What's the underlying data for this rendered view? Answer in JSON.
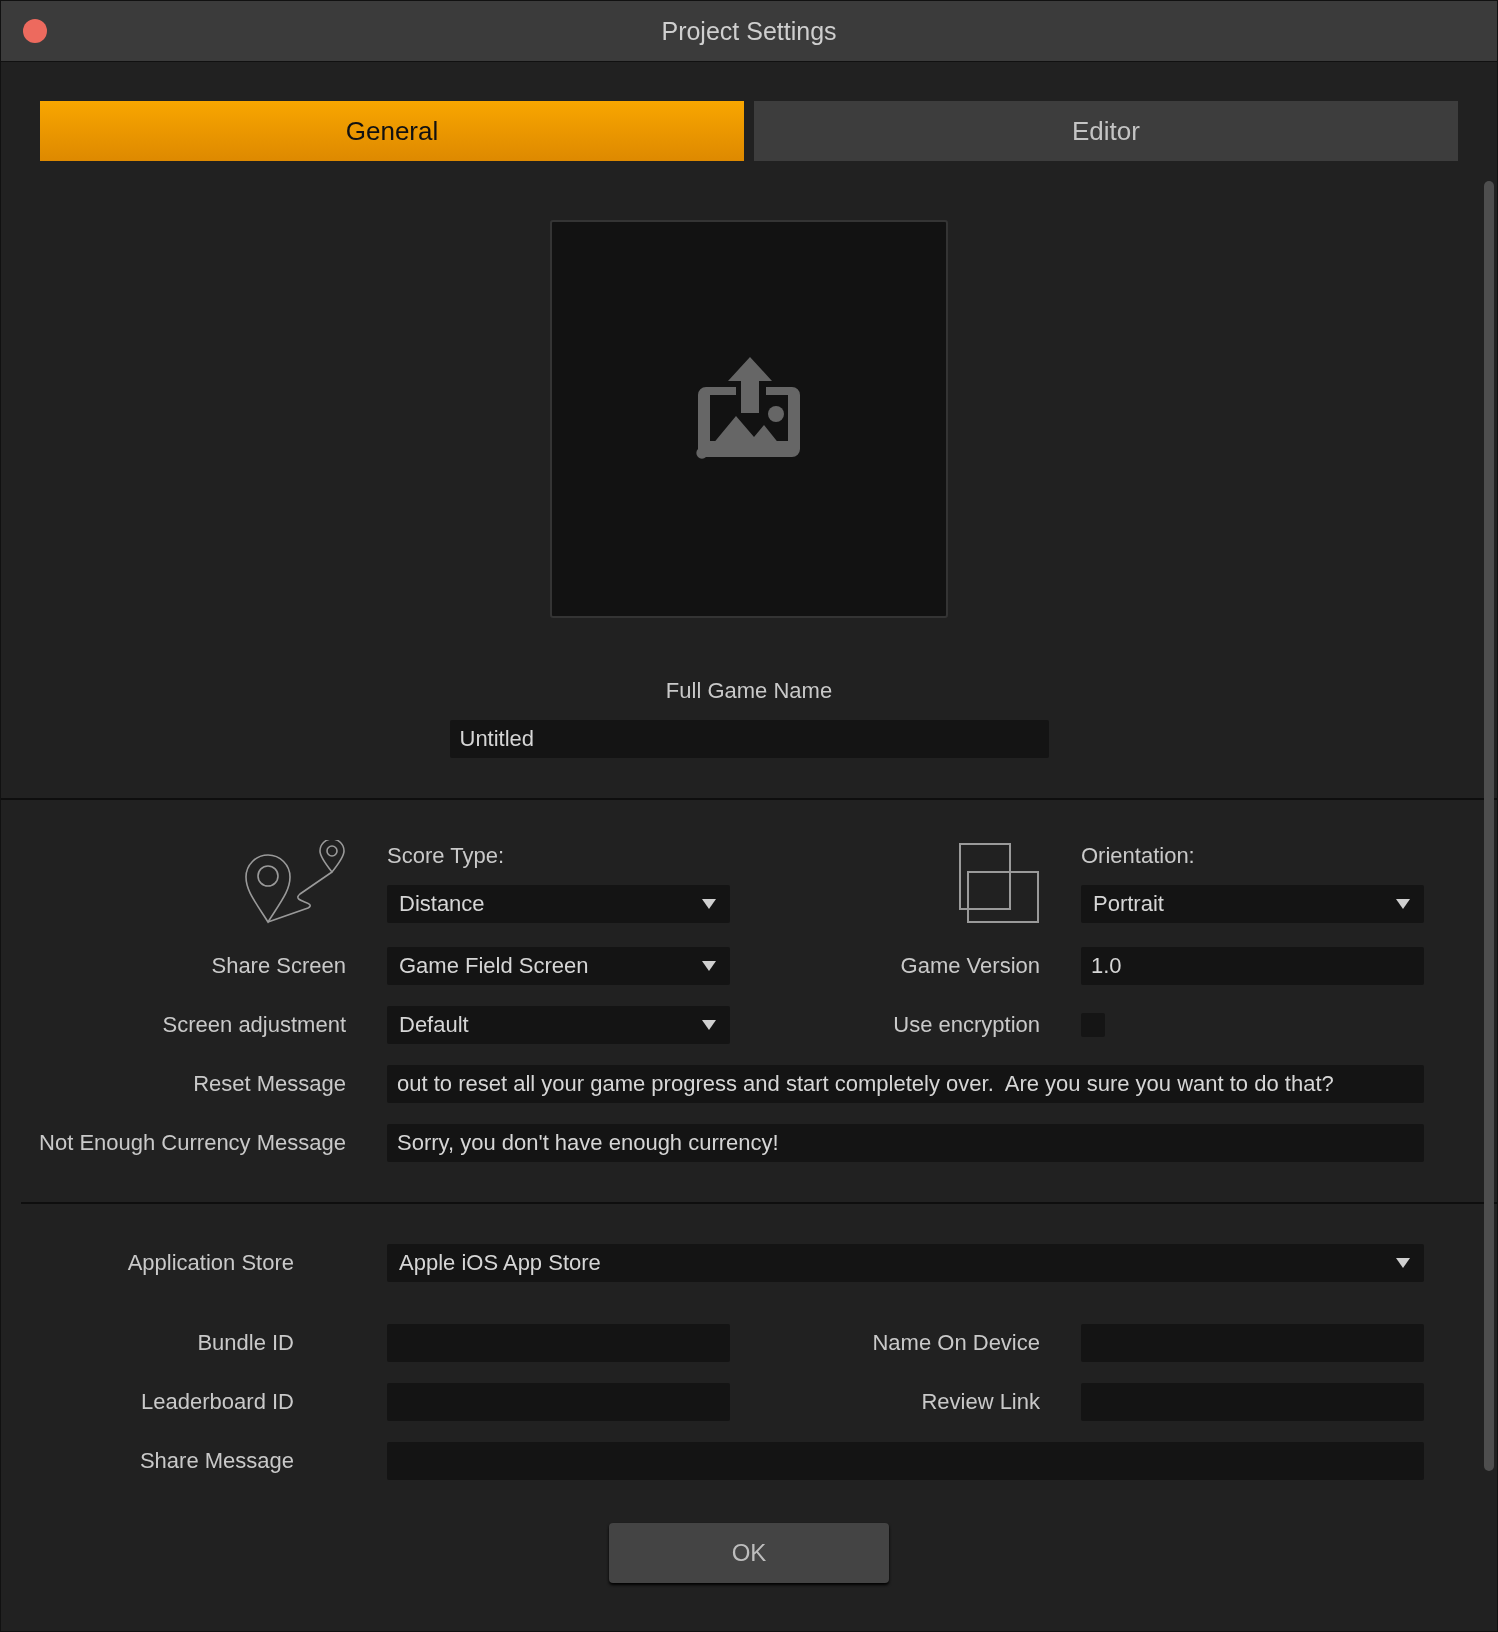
{
  "window": {
    "title": "Project Settings"
  },
  "tabs": [
    {
      "label": "General",
      "selected": true
    },
    {
      "label": "Editor",
      "selected": false
    }
  ],
  "full_game_name": {
    "label": "Full Game Name",
    "value": "Untitled"
  },
  "score_type": {
    "label": "Score Type:",
    "value": "Distance"
  },
  "orientation": {
    "label": "Orientation:",
    "value": "Portrait"
  },
  "share_screen": {
    "label": "Share Screen",
    "value": "Game Field Screen"
  },
  "game_version": {
    "label": "Game Version",
    "value": "1.0"
  },
  "screen_adjustment": {
    "label": "Screen adjustment",
    "value": "Default"
  },
  "use_encryption": {
    "label": "Use encryption",
    "checked": false
  },
  "reset_message": {
    "label": "Reset Message",
    "value": "out to reset all your game progress and start completely over.  Are you sure you want to do that?"
  },
  "not_enough_currency_message": {
    "label": "Not Enough Currency Message",
    "value": "Sorry, you don't have enough currency!"
  },
  "application_store": {
    "label": "Application Store",
    "value": "Apple iOS App Store"
  },
  "bundle_id": {
    "label": "Bundle ID"
  },
  "name_on_device": {
    "label": "Name On Device"
  },
  "leaderboard_id": {
    "label": "Leaderboard ID"
  },
  "review_link": {
    "label": "Review Link"
  },
  "share_message": {
    "label": "Share Message"
  },
  "ok_button": "OK"
}
